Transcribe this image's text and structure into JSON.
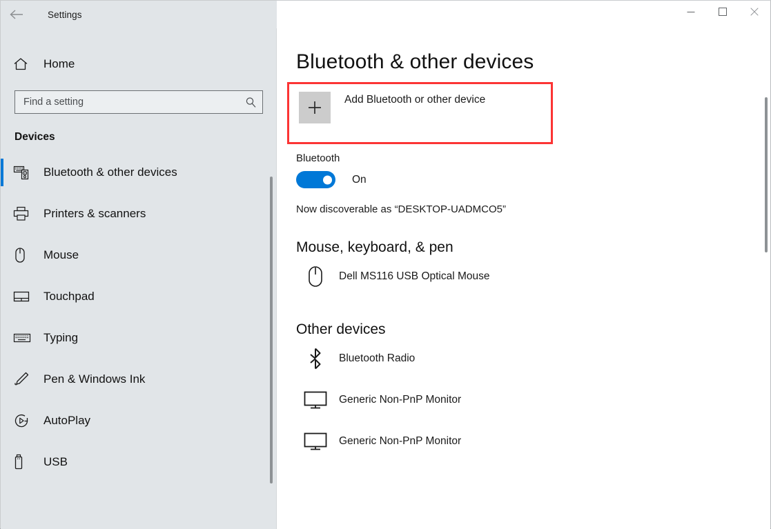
{
  "window": {
    "title": "Settings",
    "back_icon": "back-arrow-icon",
    "controls": [
      {
        "name": "minimize-button",
        "glyph": "minimize-icon"
      },
      {
        "name": "maximize-button",
        "glyph": "maximize-icon"
      },
      {
        "name": "close-button",
        "glyph": "close-icon"
      }
    ]
  },
  "sidebar": {
    "home_label": "Home",
    "home_icon": "home-icon",
    "search": {
      "placeholder": "Find a setting",
      "value": "",
      "icon": "search-icon"
    },
    "section_title": "Devices",
    "items": [
      {
        "label": "Bluetooth & other devices",
        "icon": "bluetooth-devices-icon",
        "selected": true
      },
      {
        "label": "Printers & scanners",
        "icon": "printer-icon",
        "selected": false
      },
      {
        "label": "Mouse",
        "icon": "mouse-icon",
        "selected": false
      },
      {
        "label": "Touchpad",
        "icon": "touchpad-icon",
        "selected": false
      },
      {
        "label": "Typing",
        "icon": "keyboard-icon",
        "selected": false
      },
      {
        "label": "Pen & Windows Ink",
        "icon": "pen-icon",
        "selected": false
      },
      {
        "label": "AutoPlay",
        "icon": "autoplay-icon",
        "selected": false
      },
      {
        "label": "USB",
        "icon": "usb-icon",
        "selected": false
      }
    ]
  },
  "main": {
    "page_title": "Bluetooth & other devices",
    "add_device": {
      "label": "Add Bluetooth or other device",
      "icon": "plus-icon",
      "highlight_color": "#fc3434"
    },
    "bluetooth": {
      "label": "Bluetooth",
      "toggle_state": "On",
      "toggle_on": true,
      "accent_color": "#0078d7",
      "discoverable_text": "Now discoverable as “DESKTOP-UADMCO5”"
    },
    "groups": [
      {
        "heading": "Mouse, keyboard, & pen",
        "devices": [
          {
            "name": "Dell MS116 USB Optical Mouse",
            "icon": "mouse-icon"
          }
        ]
      },
      {
        "heading": "Other devices",
        "devices": [
          {
            "name": "Bluetooth Radio",
            "icon": "bluetooth-icon"
          },
          {
            "name": "Generic Non-PnP Monitor",
            "icon": "monitor-icon"
          },
          {
            "name": "Generic Non-PnP Monitor",
            "icon": "monitor-icon"
          }
        ]
      }
    ]
  }
}
